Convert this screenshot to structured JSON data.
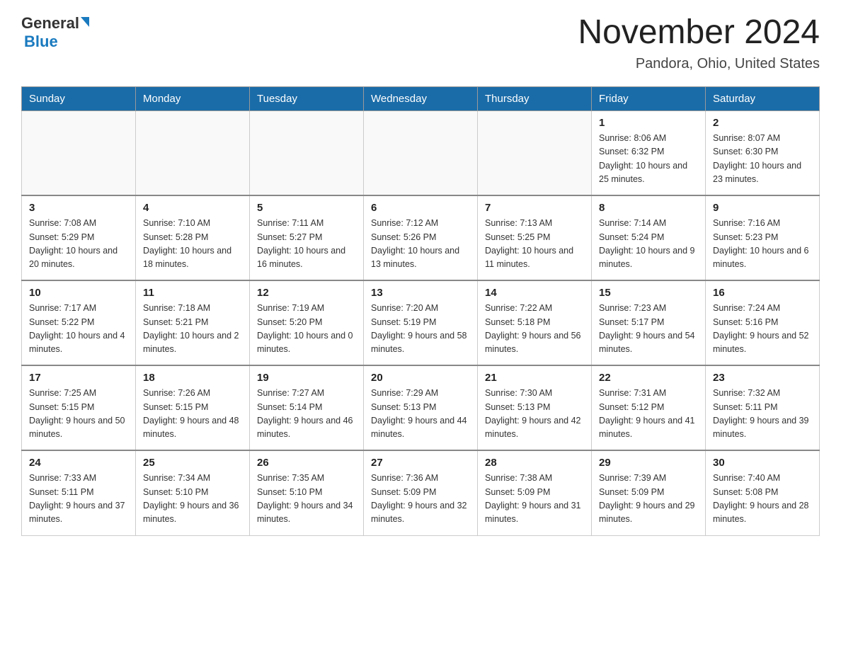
{
  "logo": {
    "text_general": "General",
    "text_blue": "Blue"
  },
  "title": "November 2024",
  "subtitle": "Pandora, Ohio, United States",
  "weekdays": [
    "Sunday",
    "Monday",
    "Tuesday",
    "Wednesday",
    "Thursday",
    "Friday",
    "Saturday"
  ],
  "weeks": [
    [
      {
        "day": "",
        "sunrise": "",
        "sunset": "",
        "daylight": ""
      },
      {
        "day": "",
        "sunrise": "",
        "sunset": "",
        "daylight": ""
      },
      {
        "day": "",
        "sunrise": "",
        "sunset": "",
        "daylight": ""
      },
      {
        "day": "",
        "sunrise": "",
        "sunset": "",
        "daylight": ""
      },
      {
        "day": "",
        "sunrise": "",
        "sunset": "",
        "daylight": ""
      },
      {
        "day": "1",
        "sunrise": "Sunrise: 8:06 AM",
        "sunset": "Sunset: 6:32 PM",
        "daylight": "Daylight: 10 hours and 25 minutes."
      },
      {
        "day": "2",
        "sunrise": "Sunrise: 8:07 AM",
        "sunset": "Sunset: 6:30 PM",
        "daylight": "Daylight: 10 hours and 23 minutes."
      }
    ],
    [
      {
        "day": "3",
        "sunrise": "Sunrise: 7:08 AM",
        "sunset": "Sunset: 5:29 PM",
        "daylight": "Daylight: 10 hours and 20 minutes."
      },
      {
        "day": "4",
        "sunrise": "Sunrise: 7:10 AM",
        "sunset": "Sunset: 5:28 PM",
        "daylight": "Daylight: 10 hours and 18 minutes."
      },
      {
        "day": "5",
        "sunrise": "Sunrise: 7:11 AM",
        "sunset": "Sunset: 5:27 PM",
        "daylight": "Daylight: 10 hours and 16 minutes."
      },
      {
        "day": "6",
        "sunrise": "Sunrise: 7:12 AM",
        "sunset": "Sunset: 5:26 PM",
        "daylight": "Daylight: 10 hours and 13 minutes."
      },
      {
        "day": "7",
        "sunrise": "Sunrise: 7:13 AM",
        "sunset": "Sunset: 5:25 PM",
        "daylight": "Daylight: 10 hours and 11 minutes."
      },
      {
        "day": "8",
        "sunrise": "Sunrise: 7:14 AM",
        "sunset": "Sunset: 5:24 PM",
        "daylight": "Daylight: 10 hours and 9 minutes."
      },
      {
        "day": "9",
        "sunrise": "Sunrise: 7:16 AM",
        "sunset": "Sunset: 5:23 PM",
        "daylight": "Daylight: 10 hours and 6 minutes."
      }
    ],
    [
      {
        "day": "10",
        "sunrise": "Sunrise: 7:17 AM",
        "sunset": "Sunset: 5:22 PM",
        "daylight": "Daylight: 10 hours and 4 minutes."
      },
      {
        "day": "11",
        "sunrise": "Sunrise: 7:18 AM",
        "sunset": "Sunset: 5:21 PM",
        "daylight": "Daylight: 10 hours and 2 minutes."
      },
      {
        "day": "12",
        "sunrise": "Sunrise: 7:19 AM",
        "sunset": "Sunset: 5:20 PM",
        "daylight": "Daylight: 10 hours and 0 minutes."
      },
      {
        "day": "13",
        "sunrise": "Sunrise: 7:20 AM",
        "sunset": "Sunset: 5:19 PM",
        "daylight": "Daylight: 9 hours and 58 minutes."
      },
      {
        "day": "14",
        "sunrise": "Sunrise: 7:22 AM",
        "sunset": "Sunset: 5:18 PM",
        "daylight": "Daylight: 9 hours and 56 minutes."
      },
      {
        "day": "15",
        "sunrise": "Sunrise: 7:23 AM",
        "sunset": "Sunset: 5:17 PM",
        "daylight": "Daylight: 9 hours and 54 minutes."
      },
      {
        "day": "16",
        "sunrise": "Sunrise: 7:24 AM",
        "sunset": "Sunset: 5:16 PM",
        "daylight": "Daylight: 9 hours and 52 minutes."
      }
    ],
    [
      {
        "day": "17",
        "sunrise": "Sunrise: 7:25 AM",
        "sunset": "Sunset: 5:15 PM",
        "daylight": "Daylight: 9 hours and 50 minutes."
      },
      {
        "day": "18",
        "sunrise": "Sunrise: 7:26 AM",
        "sunset": "Sunset: 5:15 PM",
        "daylight": "Daylight: 9 hours and 48 minutes."
      },
      {
        "day": "19",
        "sunrise": "Sunrise: 7:27 AM",
        "sunset": "Sunset: 5:14 PM",
        "daylight": "Daylight: 9 hours and 46 minutes."
      },
      {
        "day": "20",
        "sunrise": "Sunrise: 7:29 AM",
        "sunset": "Sunset: 5:13 PM",
        "daylight": "Daylight: 9 hours and 44 minutes."
      },
      {
        "day": "21",
        "sunrise": "Sunrise: 7:30 AM",
        "sunset": "Sunset: 5:13 PM",
        "daylight": "Daylight: 9 hours and 42 minutes."
      },
      {
        "day": "22",
        "sunrise": "Sunrise: 7:31 AM",
        "sunset": "Sunset: 5:12 PM",
        "daylight": "Daylight: 9 hours and 41 minutes."
      },
      {
        "day": "23",
        "sunrise": "Sunrise: 7:32 AM",
        "sunset": "Sunset: 5:11 PM",
        "daylight": "Daylight: 9 hours and 39 minutes."
      }
    ],
    [
      {
        "day": "24",
        "sunrise": "Sunrise: 7:33 AM",
        "sunset": "Sunset: 5:11 PM",
        "daylight": "Daylight: 9 hours and 37 minutes."
      },
      {
        "day": "25",
        "sunrise": "Sunrise: 7:34 AM",
        "sunset": "Sunset: 5:10 PM",
        "daylight": "Daylight: 9 hours and 36 minutes."
      },
      {
        "day": "26",
        "sunrise": "Sunrise: 7:35 AM",
        "sunset": "Sunset: 5:10 PM",
        "daylight": "Daylight: 9 hours and 34 minutes."
      },
      {
        "day": "27",
        "sunrise": "Sunrise: 7:36 AM",
        "sunset": "Sunset: 5:09 PM",
        "daylight": "Daylight: 9 hours and 32 minutes."
      },
      {
        "day": "28",
        "sunrise": "Sunrise: 7:38 AM",
        "sunset": "Sunset: 5:09 PM",
        "daylight": "Daylight: 9 hours and 31 minutes."
      },
      {
        "day": "29",
        "sunrise": "Sunrise: 7:39 AM",
        "sunset": "Sunset: 5:09 PM",
        "daylight": "Daylight: 9 hours and 29 minutes."
      },
      {
        "day": "30",
        "sunrise": "Sunrise: 7:40 AM",
        "sunset": "Sunset: 5:08 PM",
        "daylight": "Daylight: 9 hours and 28 minutes."
      }
    ]
  ]
}
